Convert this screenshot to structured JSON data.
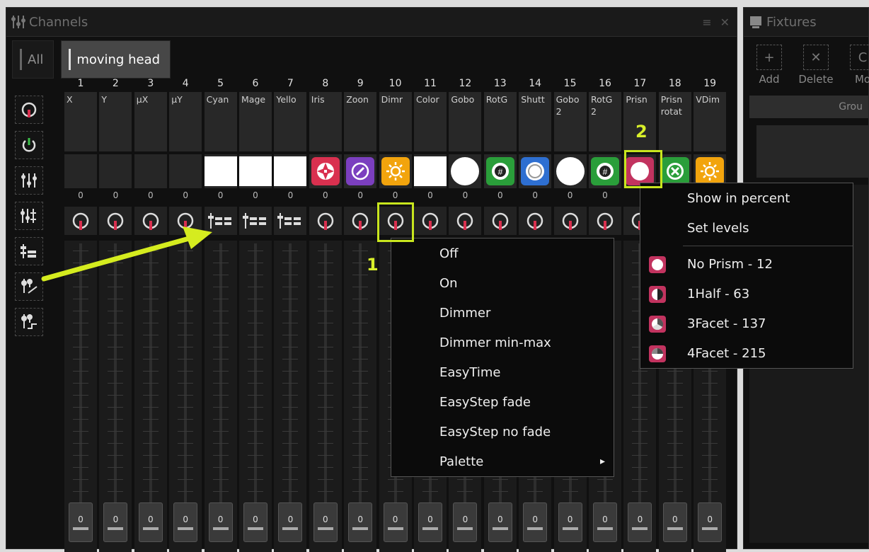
{
  "channels_panel": {
    "title": "Channels"
  },
  "fixtures_panel": {
    "title": "Fixtures",
    "tools": [
      {
        "label": "Add",
        "icon": "plus-icon"
      },
      {
        "label": "Delete",
        "icon": "x-icon"
      },
      {
        "label": "Mo",
        "icon": "move-icon"
      }
    ],
    "group_header": "Grou"
  },
  "tabs": [
    {
      "label": "All"
    },
    {
      "label": "moving head"
    }
  ],
  "sidebar": [
    "dimmer-knob-icon",
    "power-icon",
    "sliders-icon",
    "sliders-range-icon",
    "step-sliders-icon",
    "easytime-icon",
    "easystep-icon"
  ],
  "channels": [
    {
      "num": "1",
      "name": "X",
      "value": "0",
      "icon": "none",
      "color": "",
      "fader": "0"
    },
    {
      "num": "2",
      "name": "Y",
      "value": "0",
      "icon": "none",
      "color": "",
      "fader": "0"
    },
    {
      "num": "3",
      "name": "µX",
      "value": "0",
      "icon": "none",
      "color": "",
      "fader": "0"
    },
    {
      "num": "4",
      "name": "µY",
      "value": "0",
      "icon": "none",
      "color": "",
      "fader": "0"
    },
    {
      "num": "5",
      "name": "Cyan",
      "value": "0",
      "icon": "white-square",
      "color": "#ffffff",
      "fader": "0"
    },
    {
      "num": "6",
      "name": "Mage",
      "value": "0",
      "icon": "white-square",
      "color": "#ffffff",
      "fader": "0"
    },
    {
      "num": "7",
      "name": "Yello",
      "value": "0",
      "icon": "white-square",
      "color": "#ffffff",
      "fader": "0"
    },
    {
      "num": "8",
      "name": "Iris",
      "value": "0",
      "icon": "iris-icon",
      "color": "#d9304f",
      "fader": "0"
    },
    {
      "num": "9",
      "name": "Zoon",
      "value": "0",
      "icon": "zoom-icon",
      "color": "#7b3fbf",
      "fader": "0"
    },
    {
      "num": "10",
      "name": "Dimr",
      "value": "0",
      "icon": "sun-icon",
      "color": "#f2a40d",
      "fader": "0"
    },
    {
      "num": "11",
      "name": "Color",
      "value": "0",
      "icon": "white-square",
      "color": "#ffffff",
      "fader": "0"
    },
    {
      "num": "12",
      "name": "Gobo",
      "value": "0",
      "icon": "white-circle",
      "color": "#ffffff",
      "fader": "0"
    },
    {
      "num": "13",
      "name": "RotG",
      "value": "0",
      "icon": "gobo-rotate-icon",
      "color": "#2a9e3a",
      "fader": "0"
    },
    {
      "num": "14",
      "name": "Shutt",
      "value": "0",
      "icon": "shutter-icon",
      "color": "#2e6fd1",
      "fader": "0"
    },
    {
      "num": "15",
      "name": "Gobo\n2",
      "value": "0",
      "icon": "white-circle",
      "color": "#ffffff",
      "fader": "0"
    },
    {
      "num": "16",
      "name": "RotG\n2",
      "value": "0",
      "icon": "gobo-rotate-icon",
      "color": "#2a9e3a",
      "fader": "0"
    },
    {
      "num": "17",
      "name": "Prisn",
      "value": "",
      "icon": "prism-icon",
      "color": "#c2335f",
      "fader": "0"
    },
    {
      "num": "18",
      "name": "Prisn\nrotat",
      "value": "",
      "icon": "x-icon",
      "color": "#2a9e3a",
      "fader": "0"
    },
    {
      "num": "19",
      "name": "VDim",
      "value": "",
      "icon": "sun-icon",
      "color": "#f2a40d",
      "fader": "0"
    }
  ],
  "context_menu_1": {
    "items": [
      "Off",
      "On",
      "Dimmer",
      "Dimmer min-max",
      "EasyTime",
      "EasyStep fade",
      "EasyStep no fade",
      "Palette"
    ],
    "submenu_arrow": "▸"
  },
  "context_menu_2": {
    "top_items": [
      "Show in percent",
      "Set levels"
    ],
    "presets": [
      {
        "label": "No Prism - 12",
        "icon": "no-prism-icon"
      },
      {
        "label": "1Half - 63",
        "icon": "half-prism-icon"
      },
      {
        "label": "3Facet - 137",
        "icon": "three-facet-icon"
      },
      {
        "label": "4Facet - 215",
        "icon": "four-facet-icon"
      }
    ]
  },
  "callouts": {
    "one": "1",
    "two": "2"
  },
  "accent_color": "#c8e61e"
}
